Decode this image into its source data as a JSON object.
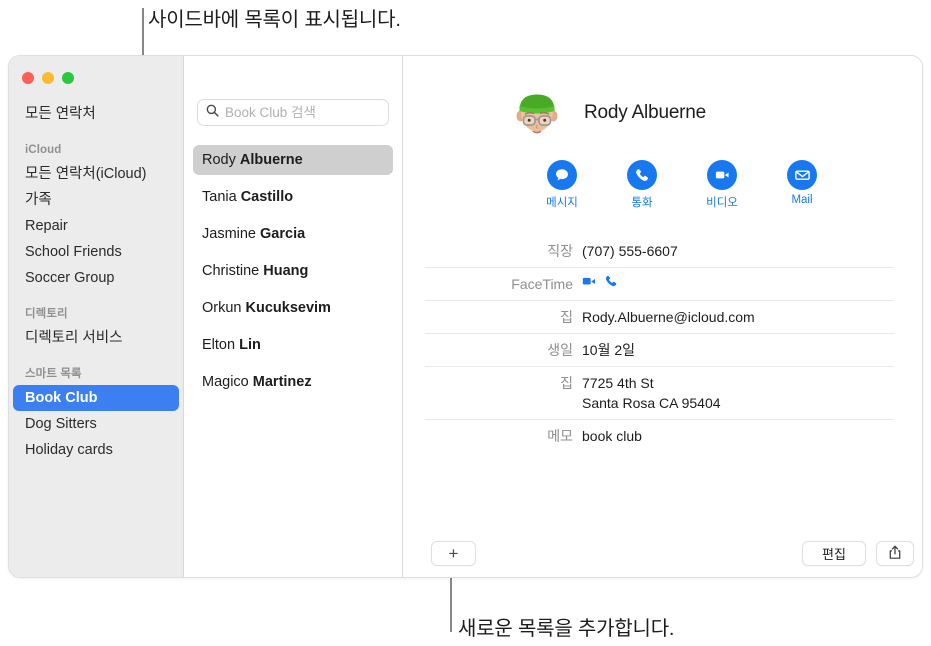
{
  "callouts": {
    "top": "사이드바에 목록이 표시됩니다.",
    "bottom": "새로운 목록을 추가합니다."
  },
  "window": {
    "traffic_lights": [
      "close",
      "minimize",
      "zoom"
    ]
  },
  "sidebar": {
    "top_items": [
      {
        "label": "모든 연락처",
        "selected": false
      }
    ],
    "groups": [
      {
        "header": "iCloud",
        "items": [
          {
            "label": "모든 연락처(iCloud)",
            "selected": false
          },
          {
            "label": "가족",
            "selected": false
          },
          {
            "label": "Repair",
            "selected": false
          },
          {
            "label": "School Friends",
            "selected": false
          },
          {
            "label": "Soccer Group",
            "selected": false
          }
        ]
      },
      {
        "header": "디렉토리",
        "items": [
          {
            "label": "디렉토리 서비스",
            "selected": false
          }
        ]
      },
      {
        "header": "스마트 목록",
        "items": [
          {
            "label": "Book Club",
            "selected": true
          },
          {
            "label": "Dog Sitters",
            "selected": false
          },
          {
            "label": "Holiday cards",
            "selected": false
          }
        ]
      }
    ]
  },
  "search": {
    "placeholder": "Book Club 검색",
    "value": "",
    "icon": "search-icon"
  },
  "contact_list": [
    {
      "first": "Rody ",
      "last": "Albuerne",
      "selected": true
    },
    {
      "first": "Tania ",
      "last": "Castillo",
      "selected": false
    },
    {
      "first": "Jasmine ",
      "last": "Garcia",
      "selected": false
    },
    {
      "first": "Christine ",
      "last": "Huang",
      "selected": false
    },
    {
      "first": "Orkun ",
      "last": "Kucuksevim",
      "selected": false
    },
    {
      "first": "Elton ",
      "last": "Lin",
      "selected": false
    },
    {
      "first": "Magico ",
      "last": "Martinez",
      "selected": false
    }
  ],
  "detail": {
    "name": "Rody Albuerne",
    "avatar": "memoji-green-beanie-glasses",
    "actions": [
      {
        "label": "메시지",
        "icon": "message-bubble-icon"
      },
      {
        "label": "통화",
        "icon": "phone-icon"
      },
      {
        "label": "비디오",
        "icon": "video-camera-icon"
      },
      {
        "label": "Mail",
        "icon": "mail-envelope-icon"
      }
    ],
    "fields": [
      {
        "label": "직장",
        "value": "(707) 555-6607",
        "type": "text"
      },
      {
        "label": "FaceTime",
        "value": "",
        "type": "icons",
        "icons": [
          "video-camera-icon",
          "phone-icon"
        ]
      },
      {
        "label": "집",
        "value": "Rody.Albuerne@icloud.com",
        "type": "text"
      },
      {
        "label": "생일",
        "value": "10월 2일",
        "type": "text"
      },
      {
        "label": "집",
        "value": "7725 4th St",
        "value2": "Santa Rosa CA 95404",
        "type": "multiline"
      },
      {
        "label": "메모",
        "value": "book club",
        "type": "text"
      }
    ]
  },
  "bottom_bar": {
    "add_label": "+",
    "edit_label": "편집",
    "share_icon": "share-icon"
  },
  "colors": {
    "accent_blue": "#1878f0",
    "selection_blue": "#3b7ff0",
    "sidebar_bg": "#ececec",
    "list_selection": "#cfcfcf"
  }
}
